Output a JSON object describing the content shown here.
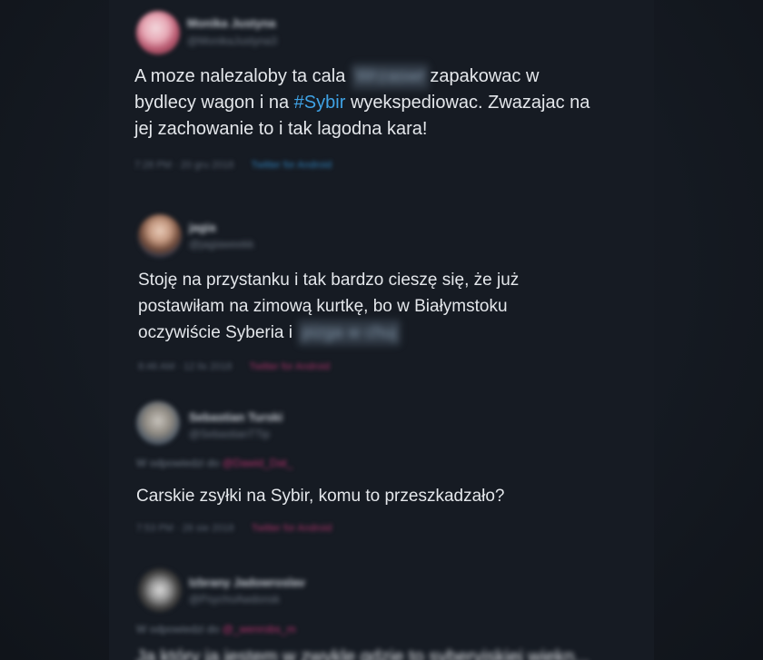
{
  "tweets": [
    {
      "author": "Monika Justyna",
      "handle": "@MonikaJustyna3",
      "text_line1_a": "A moze nalezaloby ta cala",
      "text_line1_blur": "Wrzaswr",
      "text_line1_b": "zapakowac w",
      "text_line2_a": "bydlecy wagon i na",
      "hashtag": "#Sybir",
      "text_line2_b": "wyekspediowac. Zwazajac na",
      "text_line3": "jej zachowanie to i tak lagodna kara!",
      "timestamp": "7:28 PM · 20 gru 2018",
      "source": "Twitter for Android",
      "source_color": "#2f7fb8"
    },
    {
      "author": "jagia",
      "handle": "@jagiaweekk",
      "text_line1": "Stoję na przystanku i tak bardzo cieszę się, że już",
      "text_line2": "postawiłam na zimową kurtkę, bo w Białymstoku",
      "text_line3_a": "oczywiście Syberia i",
      "text_line3_blur": "pizga w chuj",
      "timestamp": "8:46 AM · 12 lis 2018",
      "source": "Twitter for Android",
      "source_color": "#a33165"
    },
    {
      "author": "Sebastian Turski",
      "handle": "@SebastianTTip",
      "reply_label": "W odpowiedzi do",
      "reply_mention": "@Dawid_Dat_",
      "text": "Carskie zsyłki na Sybir, komu to przeszkadzało?",
      "timestamp": "7:53 PM · 26 sie 2018",
      "source": "Twitter for Android",
      "source_color": "#a33165"
    },
    {
      "author": "Izbrany Jadowroslav",
      "handle": "@PsychoAwdonsk",
      "reply_label": "W odpowiedzi do",
      "reply_mention": "@_wenrobs_m",
      "text_cutoff": "Ja który ja jestem w zwykle gdzie to syberyjskiej wiekn..."
    }
  ]
}
